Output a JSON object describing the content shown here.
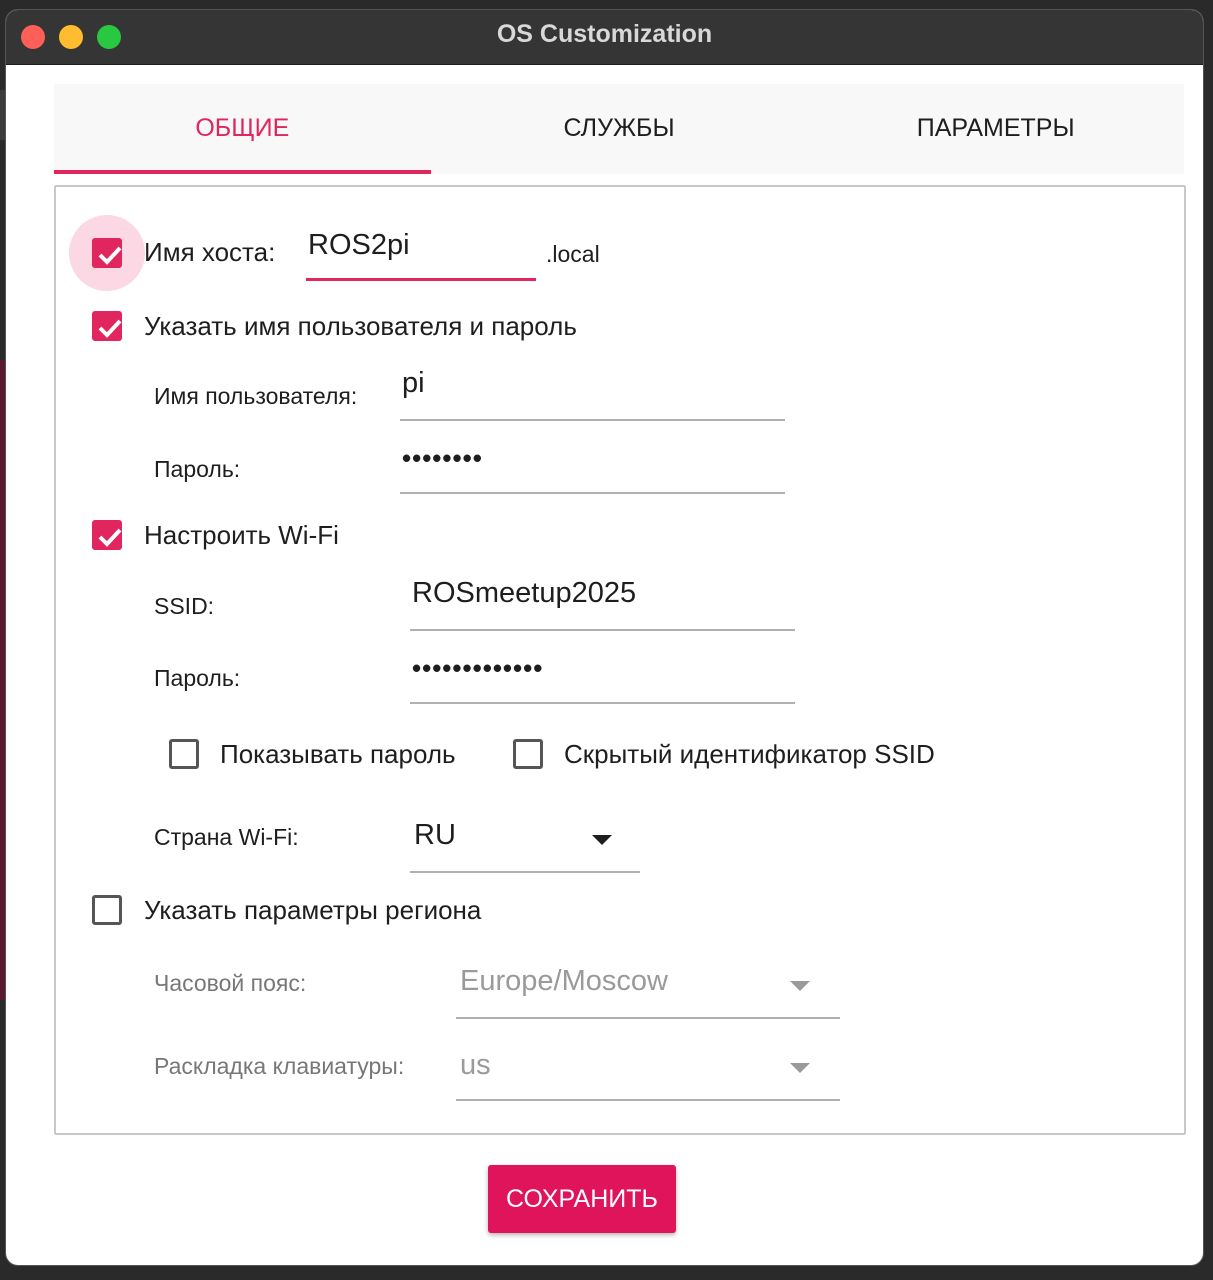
{
  "window": {
    "title": "OS Customization"
  },
  "tabs": [
    {
      "label": "ОБЩИЕ",
      "active": true
    },
    {
      "label": "СЛУЖБЫ",
      "active": false
    },
    {
      "label": "ПАРАМЕТРЫ",
      "active": false
    }
  ],
  "hostname": {
    "label": "Имя хоста:",
    "value": "ROS2pi",
    "suffix": ".local",
    "checked": true
  },
  "user": {
    "checkbox_label": "Указать имя пользователя и пароль",
    "checked": true,
    "username_label": "Имя пользователя:",
    "username_value": "pi",
    "password_label": "Пароль:",
    "password_value": "••••••••"
  },
  "wifi": {
    "checkbox_label": "Настроить Wi-Fi",
    "checked": true,
    "ssid_label": "SSID:",
    "ssid_value": "ROSmeetup2025",
    "password_label": "Пароль:",
    "password_value": "•••••••••••••",
    "show_password_label": "Показывать пароль",
    "show_password_checked": false,
    "hidden_ssid_label": "Скрытый идентификатор SSID",
    "hidden_ssid_checked": false,
    "country_label": "Страна Wi-Fi:",
    "country_value": "RU"
  },
  "locale": {
    "checkbox_label": "Указать параметры региона",
    "checked": false,
    "timezone_label": "Часовой пояс:",
    "timezone_value": "Europe/Moscow",
    "keyboard_label": "Раскладка клавиатуры:",
    "keyboard_value": "us"
  },
  "actions": {
    "save_label": "СОХРАНИТЬ"
  },
  "colors": {
    "accent": "#e0255f",
    "button": "#e0145a",
    "titlebar": "#353535"
  }
}
